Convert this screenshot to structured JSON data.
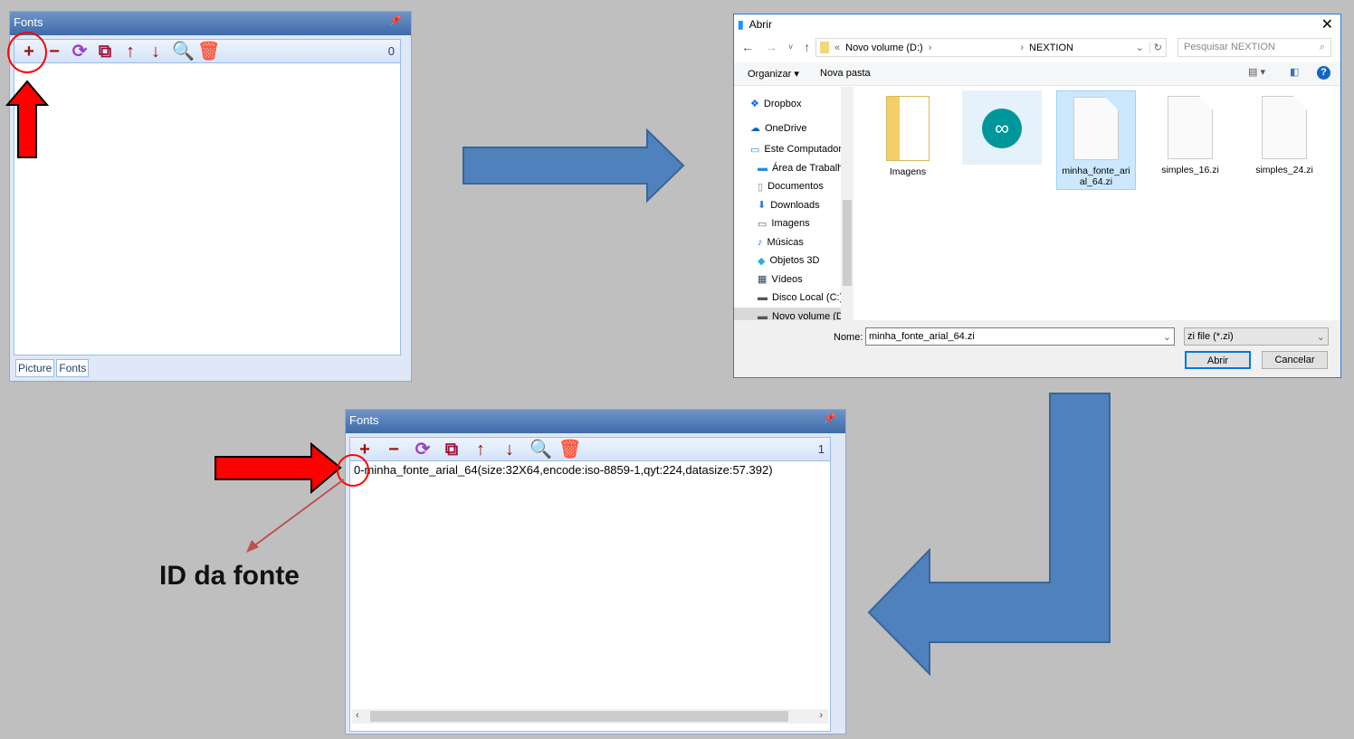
{
  "panel_before": {
    "title": "Fonts",
    "count": "0",
    "tabs": [
      "Picture",
      "Fonts"
    ]
  },
  "panel_after": {
    "title": "Fonts",
    "count": "1",
    "item": "0-minha_fonte_arial_64(size:32X64,encode:iso-8859-1,qyt:224,datasize:57.392)"
  },
  "toolbar_icons": [
    "add-icon",
    "remove-icon",
    "refresh-icon",
    "replace-icon",
    "move-up-icon",
    "move-down-icon",
    "preview-icon",
    "delete-all-icon"
  ],
  "dialog": {
    "title": "Abrir",
    "breadcrumb": [
      "«",
      "Novo volume (D:)",
      "›",
      "›",
      "NEXTION"
    ],
    "search_placeholder": "Pesquisar NEXTION",
    "organize": "Organizar ▾",
    "new_folder": "Nova pasta",
    "sidebar": [
      "Dropbox",
      "OneDrive",
      "Este Computador",
      "Área de Trabalho",
      "Documentos",
      "Downloads",
      "Imagens",
      "Músicas",
      "Objetos 3D",
      "Vídeos",
      "Disco Local (C:)",
      "Novo volume (D:)"
    ],
    "files": [
      {
        "name": "Imagens",
        "type": "folder"
      },
      {
        "name": "",
        "type": "arduino-folder"
      },
      {
        "name": "minha_fonte_arial_64.zi",
        "type": "file",
        "selected": true
      },
      {
        "name": "simples_16.zi",
        "type": "file"
      },
      {
        "name": "simples_24.zi",
        "type": "file"
      }
    ],
    "name_label": "Nome:",
    "name_value": "minha_fonte_arial_64.zi",
    "filter": "zi file (*.zi)",
    "open": "Abrir",
    "cancel": "Cancelar"
  },
  "annotation": "ID da fonte",
  "colors": {
    "arrow_blue": "#4f81bd",
    "arrow_red": "#ff0000",
    "title_blue": "#4a74b0"
  }
}
